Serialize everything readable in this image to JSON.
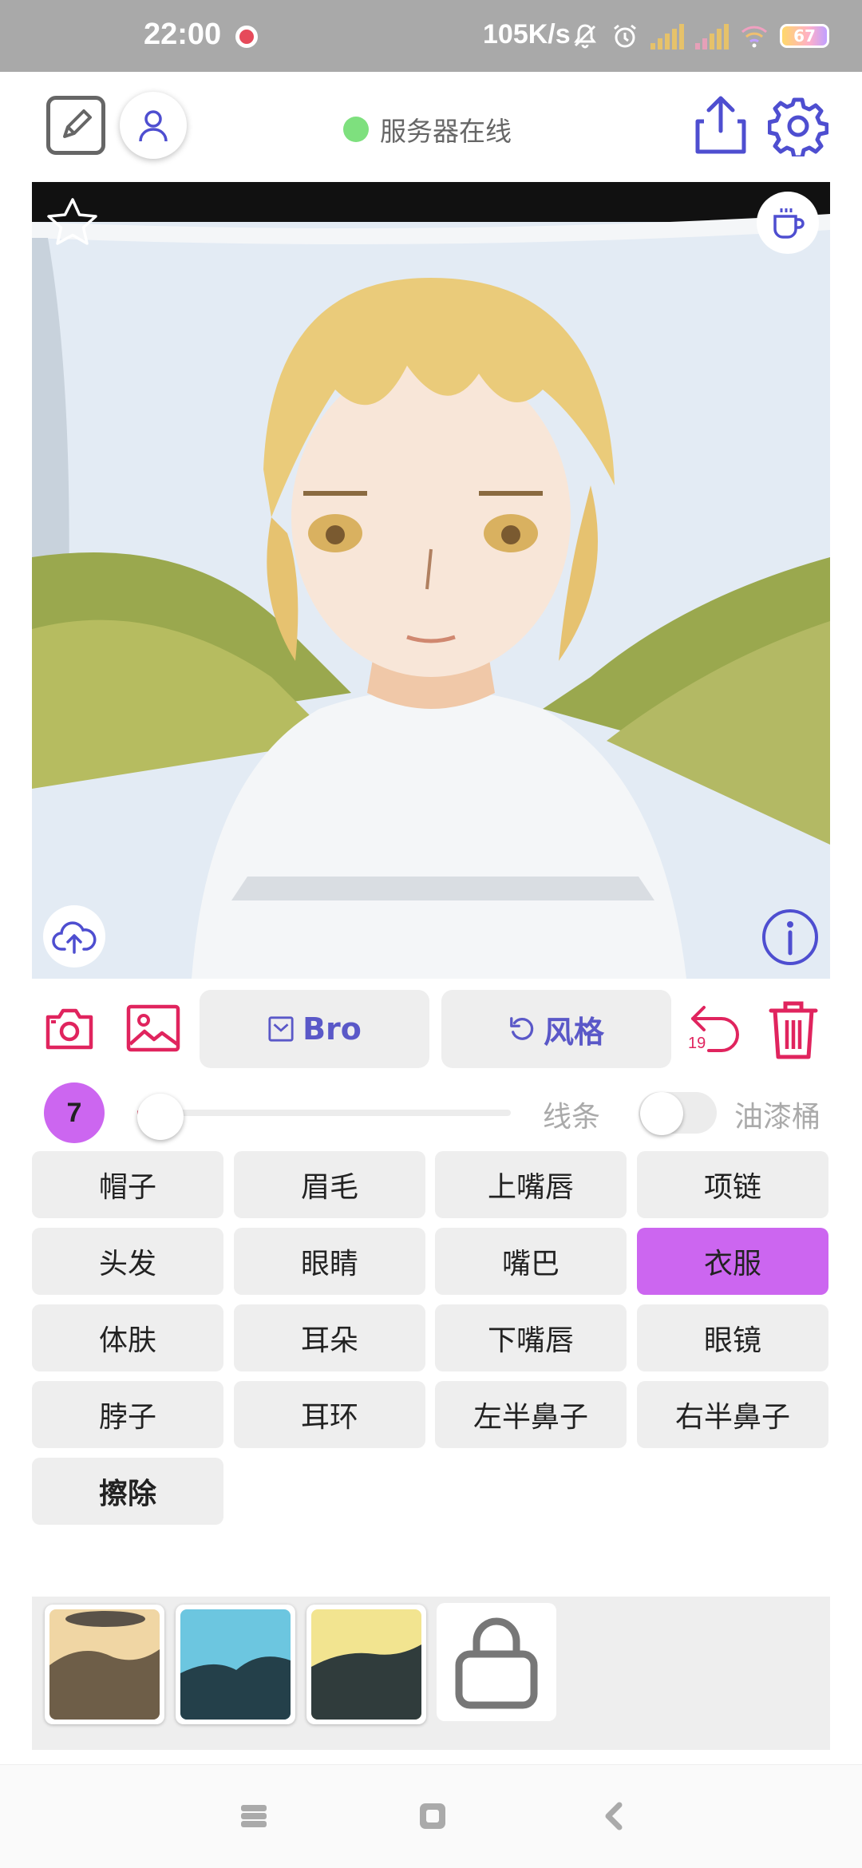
{
  "status_bar": {
    "time": "22:00",
    "network_speed": "105K/s",
    "battery": "67",
    "icons": [
      "screen-record-icon",
      "bell-off-icon",
      "alarm-icon",
      "signal-icon",
      "signal-icon",
      "wifi-icon",
      "battery-icon"
    ]
  },
  "toolbar": {
    "server_status": "服务器在线",
    "server_status_color": "#7ee07e",
    "icons": [
      "edit-icon",
      "user-icon",
      "share-icon",
      "settings-icon"
    ]
  },
  "canvas": {
    "icons": [
      "star-icon",
      "coffee-icon",
      "cloud-upload-icon",
      "info-icon"
    ]
  },
  "tools": {
    "model_label": "Bro",
    "style_label": "风格",
    "undo_count": "19",
    "accent_color": "#e0245e",
    "button_text_color": "#5a58c8"
  },
  "brush": {
    "size": "7",
    "lines_label": "线条",
    "bucket_label": "油漆桶"
  },
  "parts": [
    {
      "label": "帽子"
    },
    {
      "label": "眉毛"
    },
    {
      "label": "上嘴唇"
    },
    {
      "label": "项链"
    },
    {
      "label": "头发"
    },
    {
      "label": "眼睛"
    },
    {
      "label": "嘴巴"
    },
    {
      "label": "衣服"
    },
    {
      "label": "体肤"
    },
    {
      "label": "耳朵"
    },
    {
      "label": "下嘴唇"
    },
    {
      "label": "眼镜"
    },
    {
      "label": "脖子"
    },
    {
      "label": "耳环"
    },
    {
      "label": "左半鼻子"
    },
    {
      "label": "右半鼻子"
    },
    {
      "label": "擦除"
    }
  ],
  "selected_part": "衣服",
  "selected_color": "#cc66f0",
  "palette": {
    "icons": [
      "lock-icon"
    ]
  },
  "nav": {
    "icons": [
      "recent-apps-icon",
      "home-icon",
      "back-icon"
    ]
  }
}
